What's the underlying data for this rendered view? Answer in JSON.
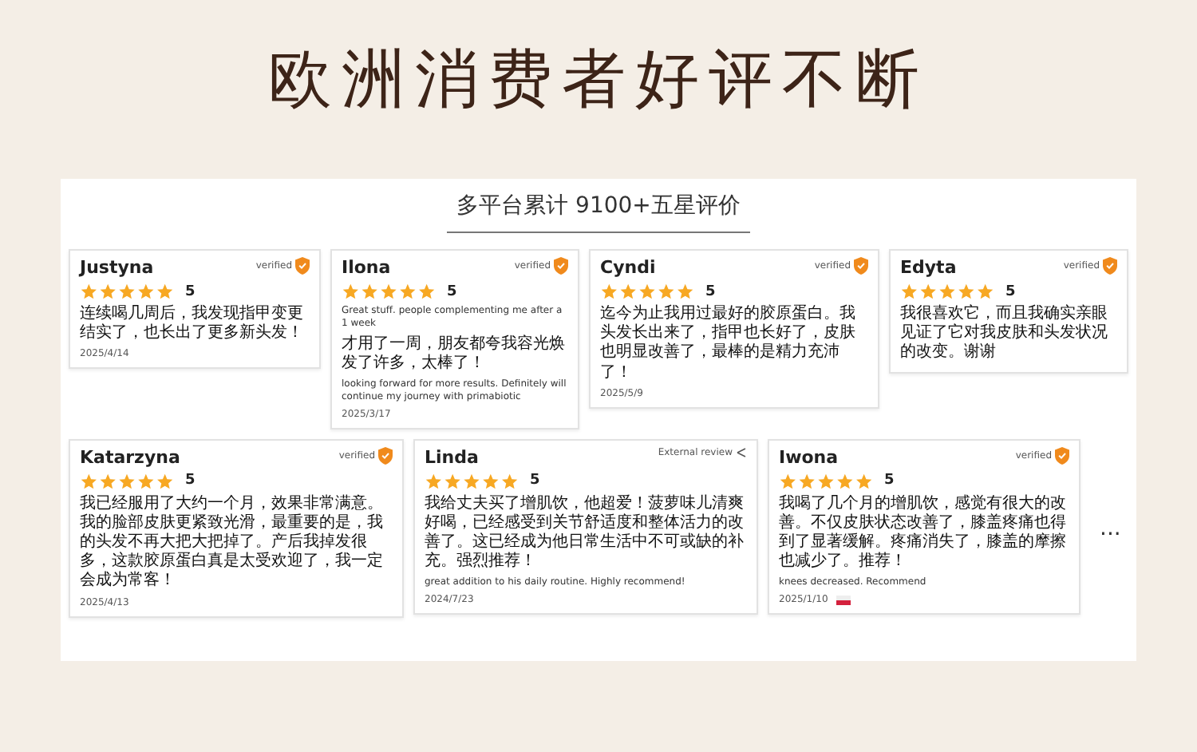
{
  "banner": {
    "title": "欧洲消费者好评不断"
  },
  "panel": {
    "heading": "多平台累计 9100+五星评价"
  },
  "rows": [
    [
      {
        "name": "Justyna",
        "badge": {
          "kind": "verified",
          "label": "verified"
        },
        "stars": 5,
        "rating": "5",
        "text": "连续喝几周后，我发现指甲变更结实了，也长出了更多新头发！",
        "date": "2025/4/14"
      },
      {
        "name": "Ilona",
        "badge": {
          "kind": "verified",
          "label": "verified"
        },
        "stars": 5,
        "rating": "5",
        "intro": "Great stuff. people complementing me after a 1 week",
        "text": "才用了一周，朋友都夸我容光焕发了许多，太棒了！",
        "extra": "looking forward for more results. Definitely will continue my journey with primabiotic",
        "date": "2025/3/17"
      },
      {
        "name": "Cyndi",
        "badge": {
          "kind": "verified",
          "label": "verified"
        },
        "stars": 5,
        "rating": "5",
        "text": "迄今为止我用过最好的胶原蛋白。我头发长出来了，指甲也长好了，皮肤也明显改善了，最棒的是精力充沛了！",
        "date": "2025/5/9"
      },
      {
        "name": "Edyta",
        "badge": {
          "kind": "verified",
          "label": "verified"
        },
        "stars": 5,
        "rating": "5",
        "text": "我很喜欢它，而且我确实亲眼见证了它对我皮肤和头发状况的改变。谢谢"
      }
    ],
    [
      {
        "name": "Katarzyna",
        "badge": {
          "kind": "verified",
          "label": "verified"
        },
        "stars": 5,
        "rating": "5",
        "text": "我已经服用了大约一个月，效果非常满意。我的脸部皮肤更紧致光滑，最重要的是，我的头发不再大把大把掉了。产后我掉发很多，这款胶原蛋白真是太受欢迎了，我一定会成为常客！",
        "date": "2025/4/13"
      },
      {
        "name": "Linda",
        "badge": {
          "kind": "external",
          "label": "External review"
        },
        "stars": 5,
        "rating": "5",
        "text": "我给丈夫买了增肌饮，他超爱！菠萝味儿清爽好喝，已经感受到关节舒适度和整体活力的改善了。这已经成为他日常生活中不可或缺的补充。强烈推荐！",
        "extra": "great addition to his daily routine. Highly recommend!",
        "date": "2024/7/23"
      },
      {
        "name": "Iwona",
        "badge": {
          "kind": "verified",
          "label": "verified"
        },
        "stars": 5,
        "rating": "5",
        "text": "我喝了几个月的增肌饮，感觉有很大的改善。不仅皮肤状态改善了，膝盖疼痛也得到了显著缓解。疼痛消失了，膝盖的摩擦也减少了。推荐！",
        "extra": "knees decreased. Recommend",
        "date": "2025/1/10"
      }
    ]
  ],
  "more": "..."
}
